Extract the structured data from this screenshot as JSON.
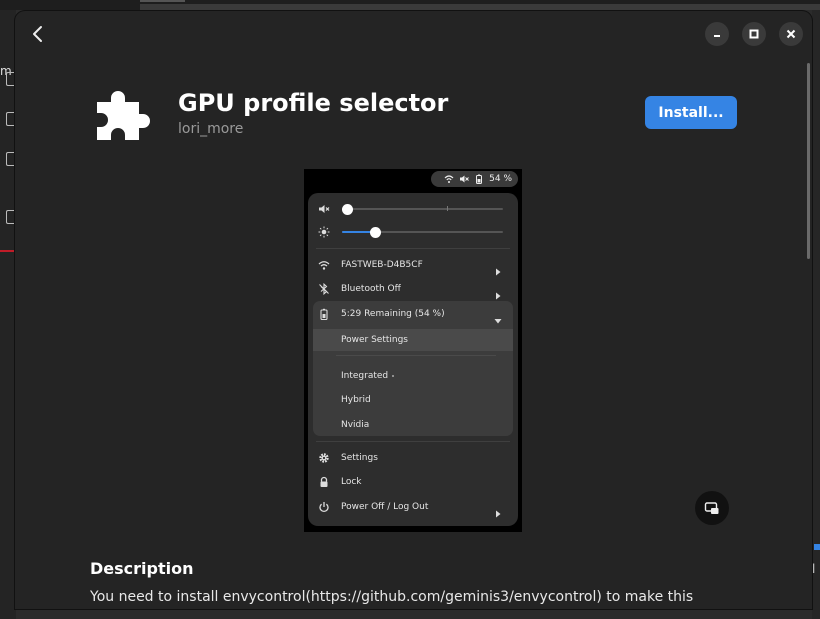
{
  "background": {
    "left_char": "m",
    "right_char": "l"
  },
  "window": {
    "controls": {
      "back_icon": "chevron-left-icon",
      "minimize_icon": "minimize-icon",
      "maximize_icon": "maximize-icon",
      "close_icon": "close-icon"
    }
  },
  "extension": {
    "title": "GPU profile selector",
    "author": "lori_more",
    "icon": "puzzle-piece-icon",
    "install_label": "Install..."
  },
  "screenshot": {
    "topbar": {
      "battery_text": "54 %"
    },
    "menu": {
      "volume_level": 0.0,
      "brightness_level": 0.21,
      "wifi_label": "FASTWEB-D4B5CF",
      "bluetooth_label": "Bluetooth Off",
      "battery_label": "5:29 Remaining (54 %)",
      "power_settings_label": "Power Settings",
      "profiles": [
        {
          "label": "Integrated",
          "selected": true
        },
        {
          "label": "Hybrid",
          "selected": false
        },
        {
          "label": "Nvidia",
          "selected": false
        }
      ],
      "settings_label": "Settings",
      "lock_label": "Lock",
      "power_off_label": "Power Off / Log Out"
    },
    "toggle_button_icon": "screenshot-icon"
  },
  "description": {
    "title": "Description",
    "text": "You need to install envycontrol(https://github.com/geminis3/envycontrol) to make this extension"
  },
  "colors": {
    "accent": "#3584e4",
    "window_bg": "#242424"
  }
}
